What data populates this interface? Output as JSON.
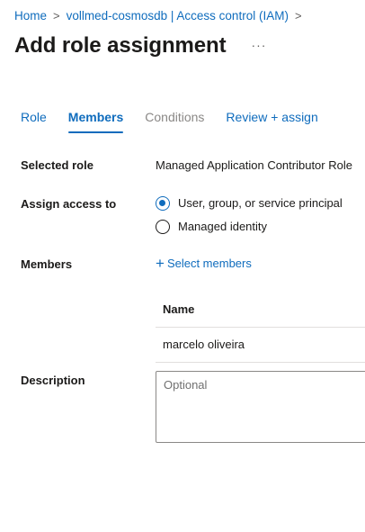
{
  "breadcrumb": {
    "items": [
      "Home",
      "vollmed-cosmosdb | Access control (IAM)"
    ],
    "separator": ">"
  },
  "header": {
    "title": "Add role assignment",
    "more_label": "···"
  },
  "tabs": [
    {
      "label": "Role",
      "state": "link"
    },
    {
      "label": "Members",
      "state": "active"
    },
    {
      "label": "Conditions",
      "state": "disabled"
    },
    {
      "label": "Review + assign",
      "state": "link"
    }
  ],
  "form": {
    "selected_role": {
      "label": "Selected role",
      "value": "Managed Application Contributor Role"
    },
    "assign_access": {
      "label": "Assign access to",
      "options": [
        {
          "label": "User, group, or service principal",
          "checked": true
        },
        {
          "label": "Managed identity",
          "checked": false
        }
      ]
    },
    "members": {
      "label": "Members",
      "select_label": "Select members",
      "table": {
        "header": "Name",
        "rows": [
          "marcelo oliveira"
        ]
      }
    },
    "description": {
      "label": "Description",
      "placeholder": "Optional",
      "value": ""
    }
  },
  "colors": {
    "accent": "#0f6cbd",
    "text": "#1b1a19",
    "disabled": "#8a8886",
    "border": "#8a8886",
    "divider": "#e1dfdd"
  },
  "icons": {
    "breadcrumb_separator": "chevron-right-icon",
    "more": "ellipsis-icon",
    "select_members": "plus-icon"
  }
}
